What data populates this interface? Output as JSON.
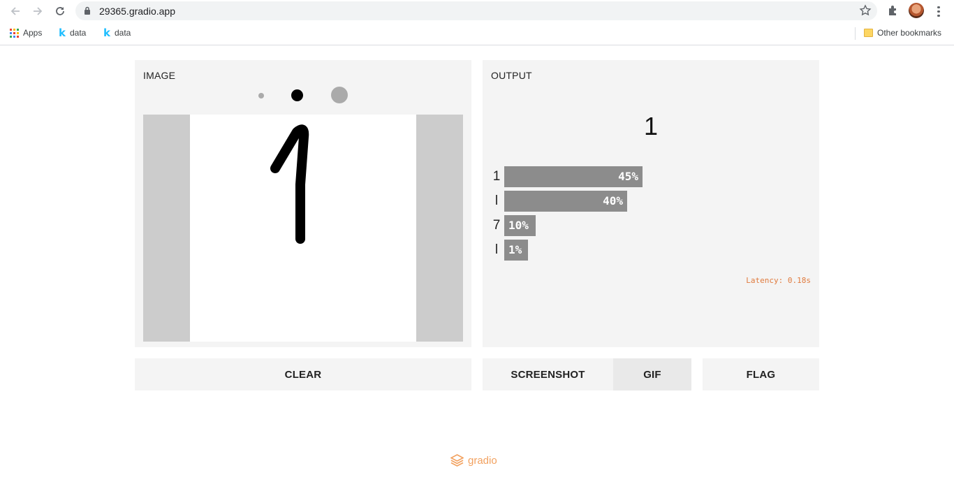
{
  "browser": {
    "url": "29365.gradio.app",
    "bookmarks": [
      {
        "label": "Apps",
        "icon": "apps-grid-icon"
      },
      {
        "label": "data",
        "icon": "kaggle-icon"
      },
      {
        "label": "data",
        "icon": "kaggle-icon"
      }
    ],
    "other_bookmarks": "Other bookmarks"
  },
  "input_panel": {
    "title": "IMAGE",
    "brush_sizes": [
      "small",
      "medium",
      "large"
    ],
    "selected_brush": "medium"
  },
  "output_panel": {
    "title": "OUTPUT",
    "predicted_label": "1",
    "confidences": [
      {
        "label": "1",
        "value": "45%",
        "fraction": 0.45
      },
      {
        "label": "l",
        "value": "40%",
        "fraction": 0.4
      },
      {
        "label": "7",
        "value": "10%",
        "fraction": 0.1
      },
      {
        "label": "l",
        "value": "1%",
        "fraction": 0.01
      }
    ],
    "latency": "Latency: 0.18s"
  },
  "buttons": {
    "clear": "CLEAR",
    "screenshot": "SCREENSHOT",
    "gif": "GIF",
    "flag": "FLAG"
  },
  "footer": {
    "brand": "gradio"
  },
  "colors": {
    "accent": "#f2a15f",
    "bar": "#8c8c8c",
    "latency": "#e07a3d"
  }
}
